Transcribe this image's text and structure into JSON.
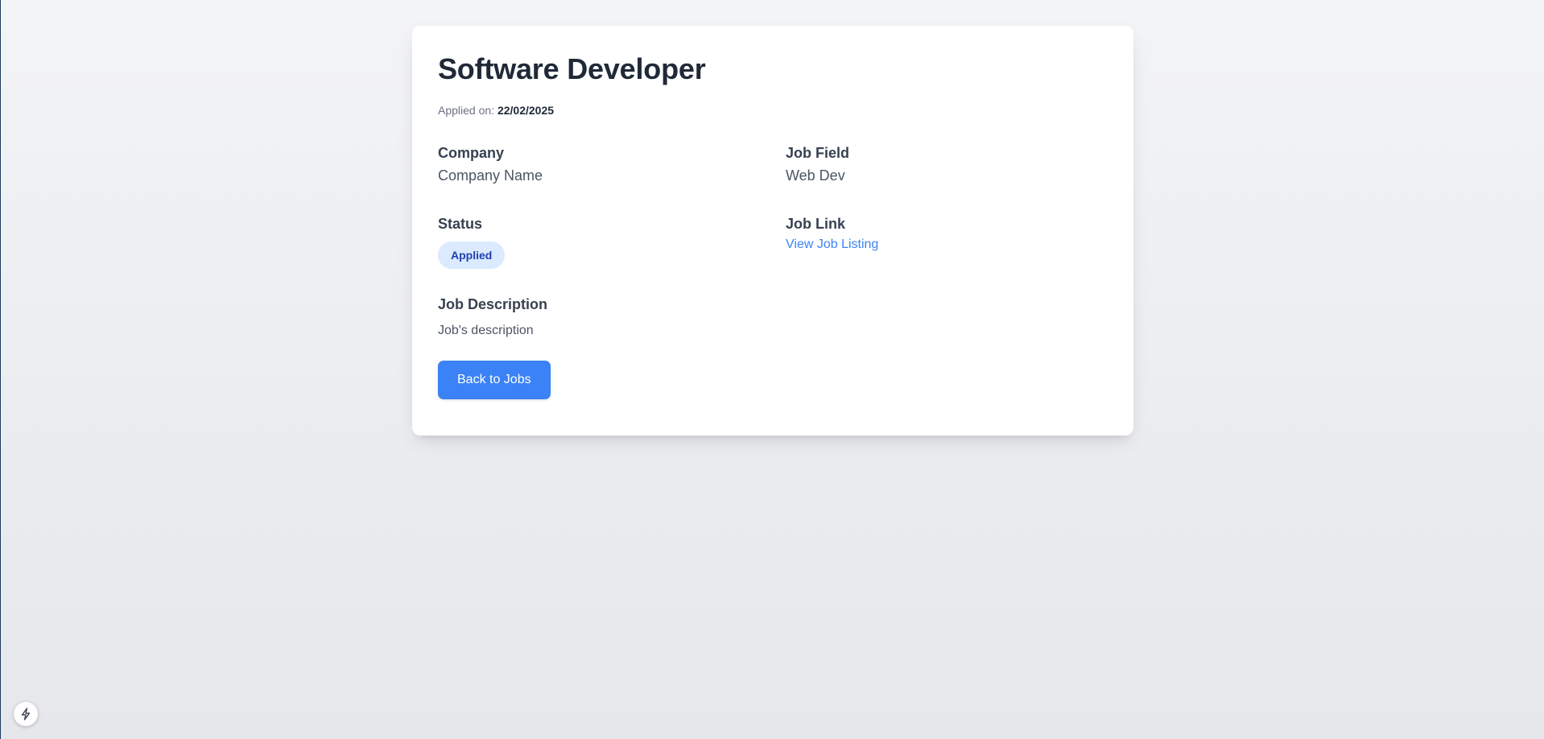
{
  "job": {
    "title": "Software Developer",
    "applied_label": "Applied on:",
    "applied_date": "22/02/2025"
  },
  "fields": {
    "company": {
      "label": "Company",
      "value": "Company Name"
    },
    "job_field": {
      "label": "Job Field",
      "value": "Web Dev"
    },
    "status": {
      "label": "Status",
      "value": "Applied"
    },
    "job_link": {
      "label": "Job Link",
      "link_text": "View Job Listing"
    },
    "description": {
      "label": "Job Description",
      "value": "Job's description"
    }
  },
  "actions": {
    "back_label": "Back to Jobs"
  },
  "icons": {
    "dev_tools": "lightning-bolt-icon"
  },
  "colors": {
    "accent": "#3b82f6",
    "badge_bg": "#dbeafe",
    "badge_text": "#1e40af",
    "title": "#1f2937"
  }
}
